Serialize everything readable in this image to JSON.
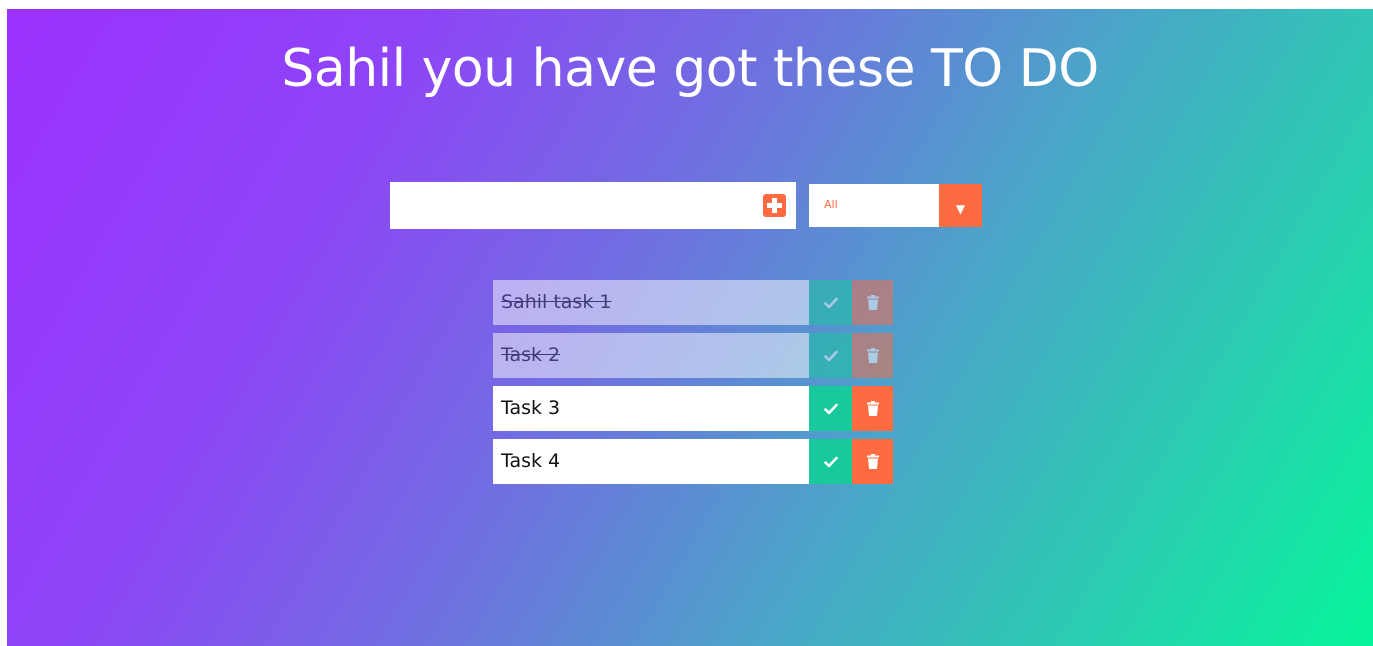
{
  "header": {
    "title": "Sahil you have got these TO DO"
  },
  "form": {
    "input_value": "",
    "input_placeholder": "",
    "add_icon": "plus-square-icon",
    "filter": {
      "selected": "All",
      "icon": "caret-down-icon"
    }
  },
  "todos": [
    {
      "text": "Sahil task 1",
      "completed": true
    },
    {
      "text": "Task 2",
      "completed": true
    },
    {
      "text": "Task 3",
      "completed": false
    },
    {
      "text": "Task 4",
      "completed": false
    }
  ],
  "icons": {
    "complete": "check-icon",
    "delete": "trash-icon"
  },
  "colors": {
    "accent": "#ff6b40",
    "complete": "#18c99b",
    "gradient_start": "#9b30ff",
    "gradient_end": "#06f59a"
  }
}
